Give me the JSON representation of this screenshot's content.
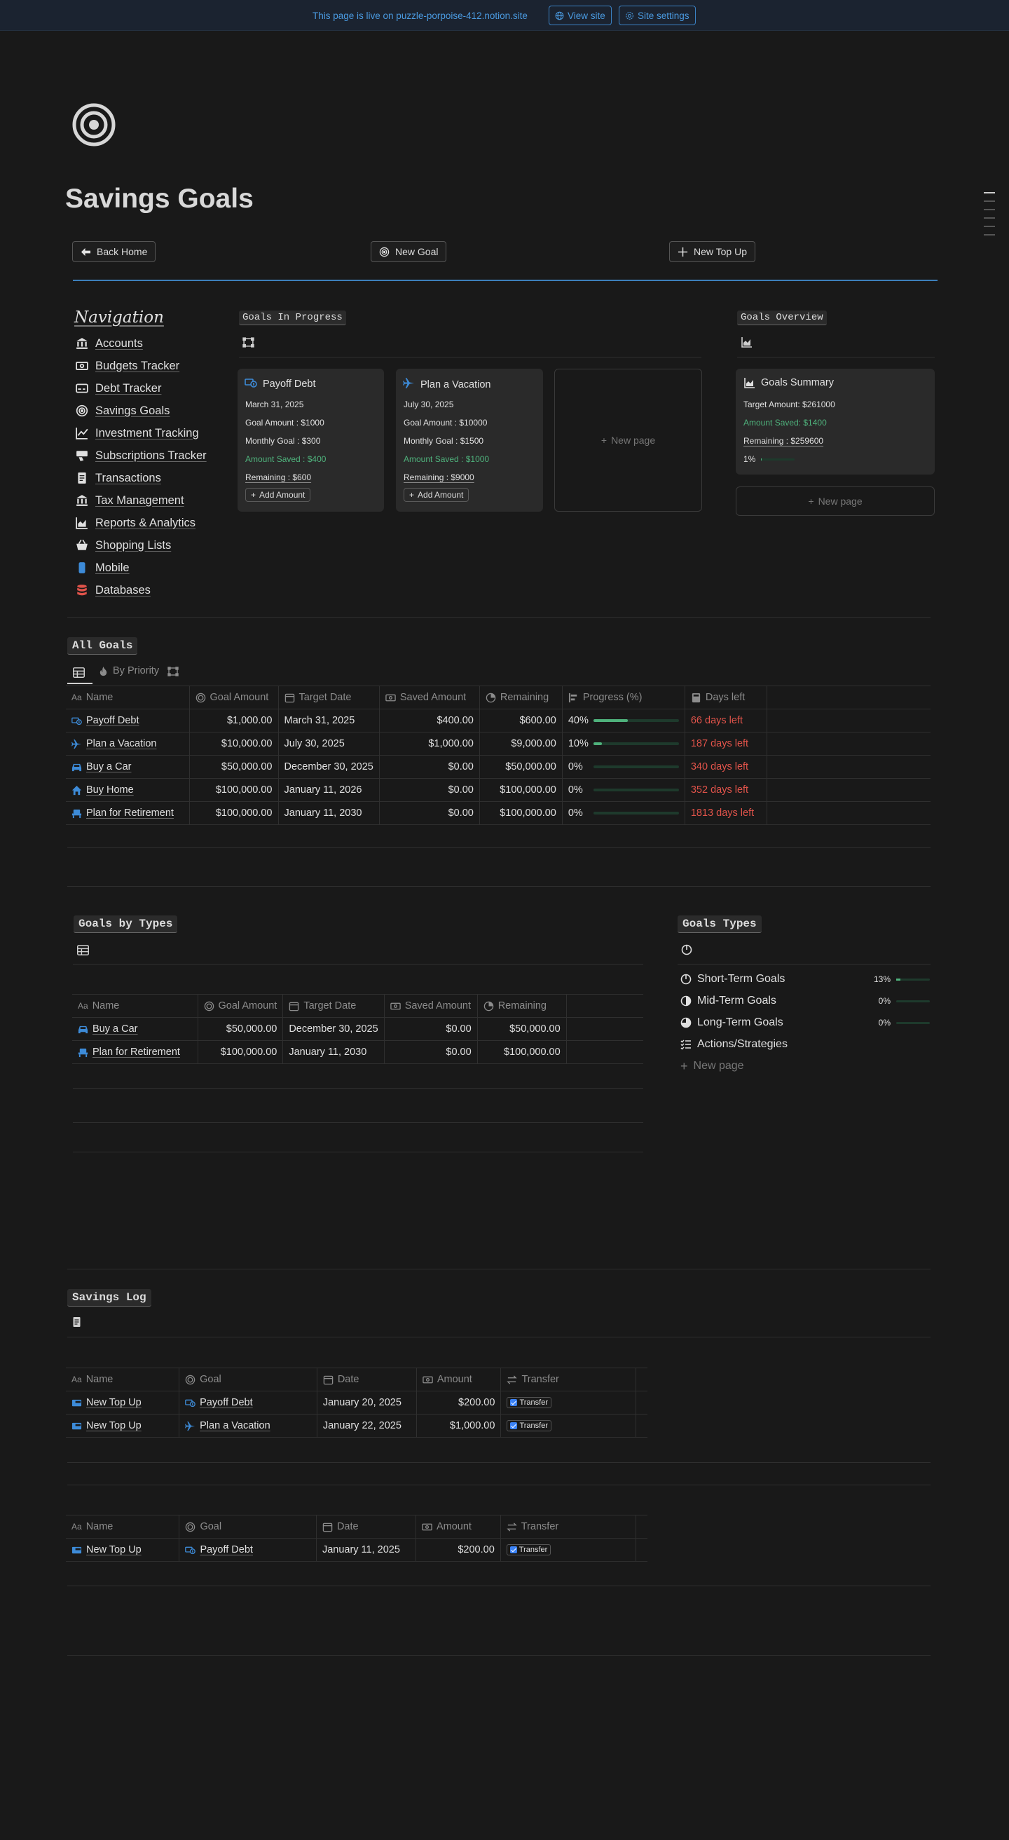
{
  "banner": {
    "text": "This page is live on puzzle-porpoise-412.notion.site",
    "view_site": "View site",
    "site_settings": "Site settings"
  },
  "page": {
    "title": "Savings Goals",
    "buttons": {
      "back_home": "Back Home",
      "new_goal": "New Goal",
      "new_top_up": "New Top Up"
    }
  },
  "navigation": {
    "title": "Navigation",
    "items": [
      {
        "label": "Accounts",
        "icon": "bank-icon"
      },
      {
        "label": "Budgets Tracker",
        "icon": "money-icon"
      },
      {
        "label": "Debt Tracker",
        "icon": "card-icon"
      },
      {
        "label": "Savings Goals",
        "icon": "target-icon"
      },
      {
        "label": "Investment Tracking",
        "icon": "chart-line-icon"
      },
      {
        "label": "Subscriptions Tracker",
        "icon": "payment-icon"
      },
      {
        "label": "Transactions",
        "icon": "receipt-icon"
      },
      {
        "label": "Tax Management",
        "icon": "bank-icon"
      },
      {
        "label": "Reports & Analytics",
        "icon": "bar-chart-icon"
      },
      {
        "label": "Shopping Lists",
        "icon": "basket-icon"
      },
      {
        "label": "Mobile",
        "icon": "mobile-icon"
      },
      {
        "label": "Databases",
        "icon": "database-icon"
      }
    ]
  },
  "goals_in_progress": {
    "heading": "Goals In Progress",
    "cards": [
      {
        "title": "Payoff Debt",
        "date": "March 31, 2025",
        "goal_amount": "Goal Amount : $1000",
        "monthly_goal": "Monthly Goal : $300",
        "amount_saved": "Amount Saved : $400",
        "remaining": "Remaining : $600",
        "add_amount": "Add Amount"
      },
      {
        "title": "Plan a Vacation",
        "date": "July 30, 2025",
        "goal_amount": "Goal Amount : $10000",
        "monthly_goal": "Monthly Goal : $1500",
        "amount_saved": "Amount Saved : $1000",
        "remaining": "Remaining : $9000",
        "add_amount": "Add Amount"
      }
    ],
    "new_page": "New page"
  },
  "goals_overview": {
    "heading": "Goals Overview",
    "card": {
      "title": "Goals Summary",
      "target_amount": "Target Amount: $261000",
      "amount_saved": "Amount Saved: $1400",
      "remaining": "Remaining : $259600",
      "percent": "1%",
      "progress": 0.01
    },
    "new_page": "New page"
  },
  "all_goals": {
    "heading": "All Goals",
    "tab_priority": "By Priority",
    "columns": [
      "Name",
      "Goal Amount",
      "Target Date",
      "Saved Amount",
      "Remaining",
      "Progress (%)",
      "Days left"
    ],
    "rows": [
      {
        "name": "Payoff Debt",
        "goal": "$1,000.00",
        "date": "March 31, 2025",
        "saved": "$400.00",
        "remaining": "$600.00",
        "progress": "40%",
        "progress_value": 0.4,
        "days": "66 days left"
      },
      {
        "name": "Plan a Vacation",
        "goal": "$10,000.00",
        "date": "July 30, 2025",
        "saved": "$1,000.00",
        "remaining": "$9,000.00",
        "progress": "10%",
        "progress_value": 0.1,
        "days": "187 days left"
      },
      {
        "name": "Buy a Car",
        "goal": "$50,000.00",
        "date": "December 30, 2025",
        "saved": "$0.00",
        "remaining": "$50,000.00",
        "progress": "0%",
        "progress_value": 0,
        "days": "340 days left"
      },
      {
        "name": "Buy Home",
        "goal": "$100,000.00",
        "date": "January 11, 2026",
        "saved": "$0.00",
        "remaining": "$100,000.00",
        "progress": "0%",
        "progress_value": 0,
        "days": "352 days left"
      },
      {
        "name": "Plan for Retirement",
        "goal": "$100,000.00",
        "date": "January 11, 2030",
        "saved": "$0.00",
        "remaining": "$100,000.00",
        "progress": "0%",
        "progress_value": 0,
        "days": "1813 days left"
      }
    ]
  },
  "goals_by_types": {
    "heading": "Goals by Types",
    "columns": [
      "Name",
      "Goal Amount",
      "Target Date",
      "Saved Amount",
      "Remaining"
    ],
    "rows": [
      {
        "name": "Buy a Car",
        "goal": "$50,000.00",
        "date": "December 30, 2025",
        "saved": "$0.00",
        "remaining": "$50,000.00"
      },
      {
        "name": "Plan for Retirement",
        "goal": "$100,000.00",
        "date": "January 11, 2030",
        "saved": "$0.00",
        "remaining": "$100,000.00"
      }
    ]
  },
  "goals_types": {
    "heading": "Goals Types",
    "items": [
      {
        "label": "Short-Term Goals",
        "percent": "13%",
        "progress": 0.13
      },
      {
        "label": "Mid-Term Goals",
        "percent": "0%",
        "progress": 0
      },
      {
        "label": "Long-Term Goals",
        "percent": "0%",
        "progress": 0
      },
      {
        "label": "Actions/Strategies"
      }
    ],
    "new_page": "New page"
  },
  "savings_log": {
    "heading": "Savings Log",
    "columns": [
      "Name",
      "Goal",
      "Date",
      "Amount",
      "Transfer"
    ],
    "group1": [
      {
        "name": "New Top Up",
        "goal": "Payoff Debt",
        "date": "January 20, 2025",
        "amount": "$200.00",
        "transfer": "Transfer"
      },
      {
        "name": "New Top Up",
        "goal": "Plan a Vacation",
        "date": "January 22, 2025",
        "amount": "$1,000.00",
        "transfer": "Transfer"
      }
    ],
    "group2": [
      {
        "name": "New Top Up",
        "goal": "Payoff Debt",
        "date": "January 11, 2025",
        "amount": "$200.00",
        "transfer": "Transfer"
      }
    ]
  },
  "colors": {
    "accent": "#3d8bd8",
    "green": "#4fb27c",
    "red": "#e0534a",
    "background": "#191919"
  }
}
